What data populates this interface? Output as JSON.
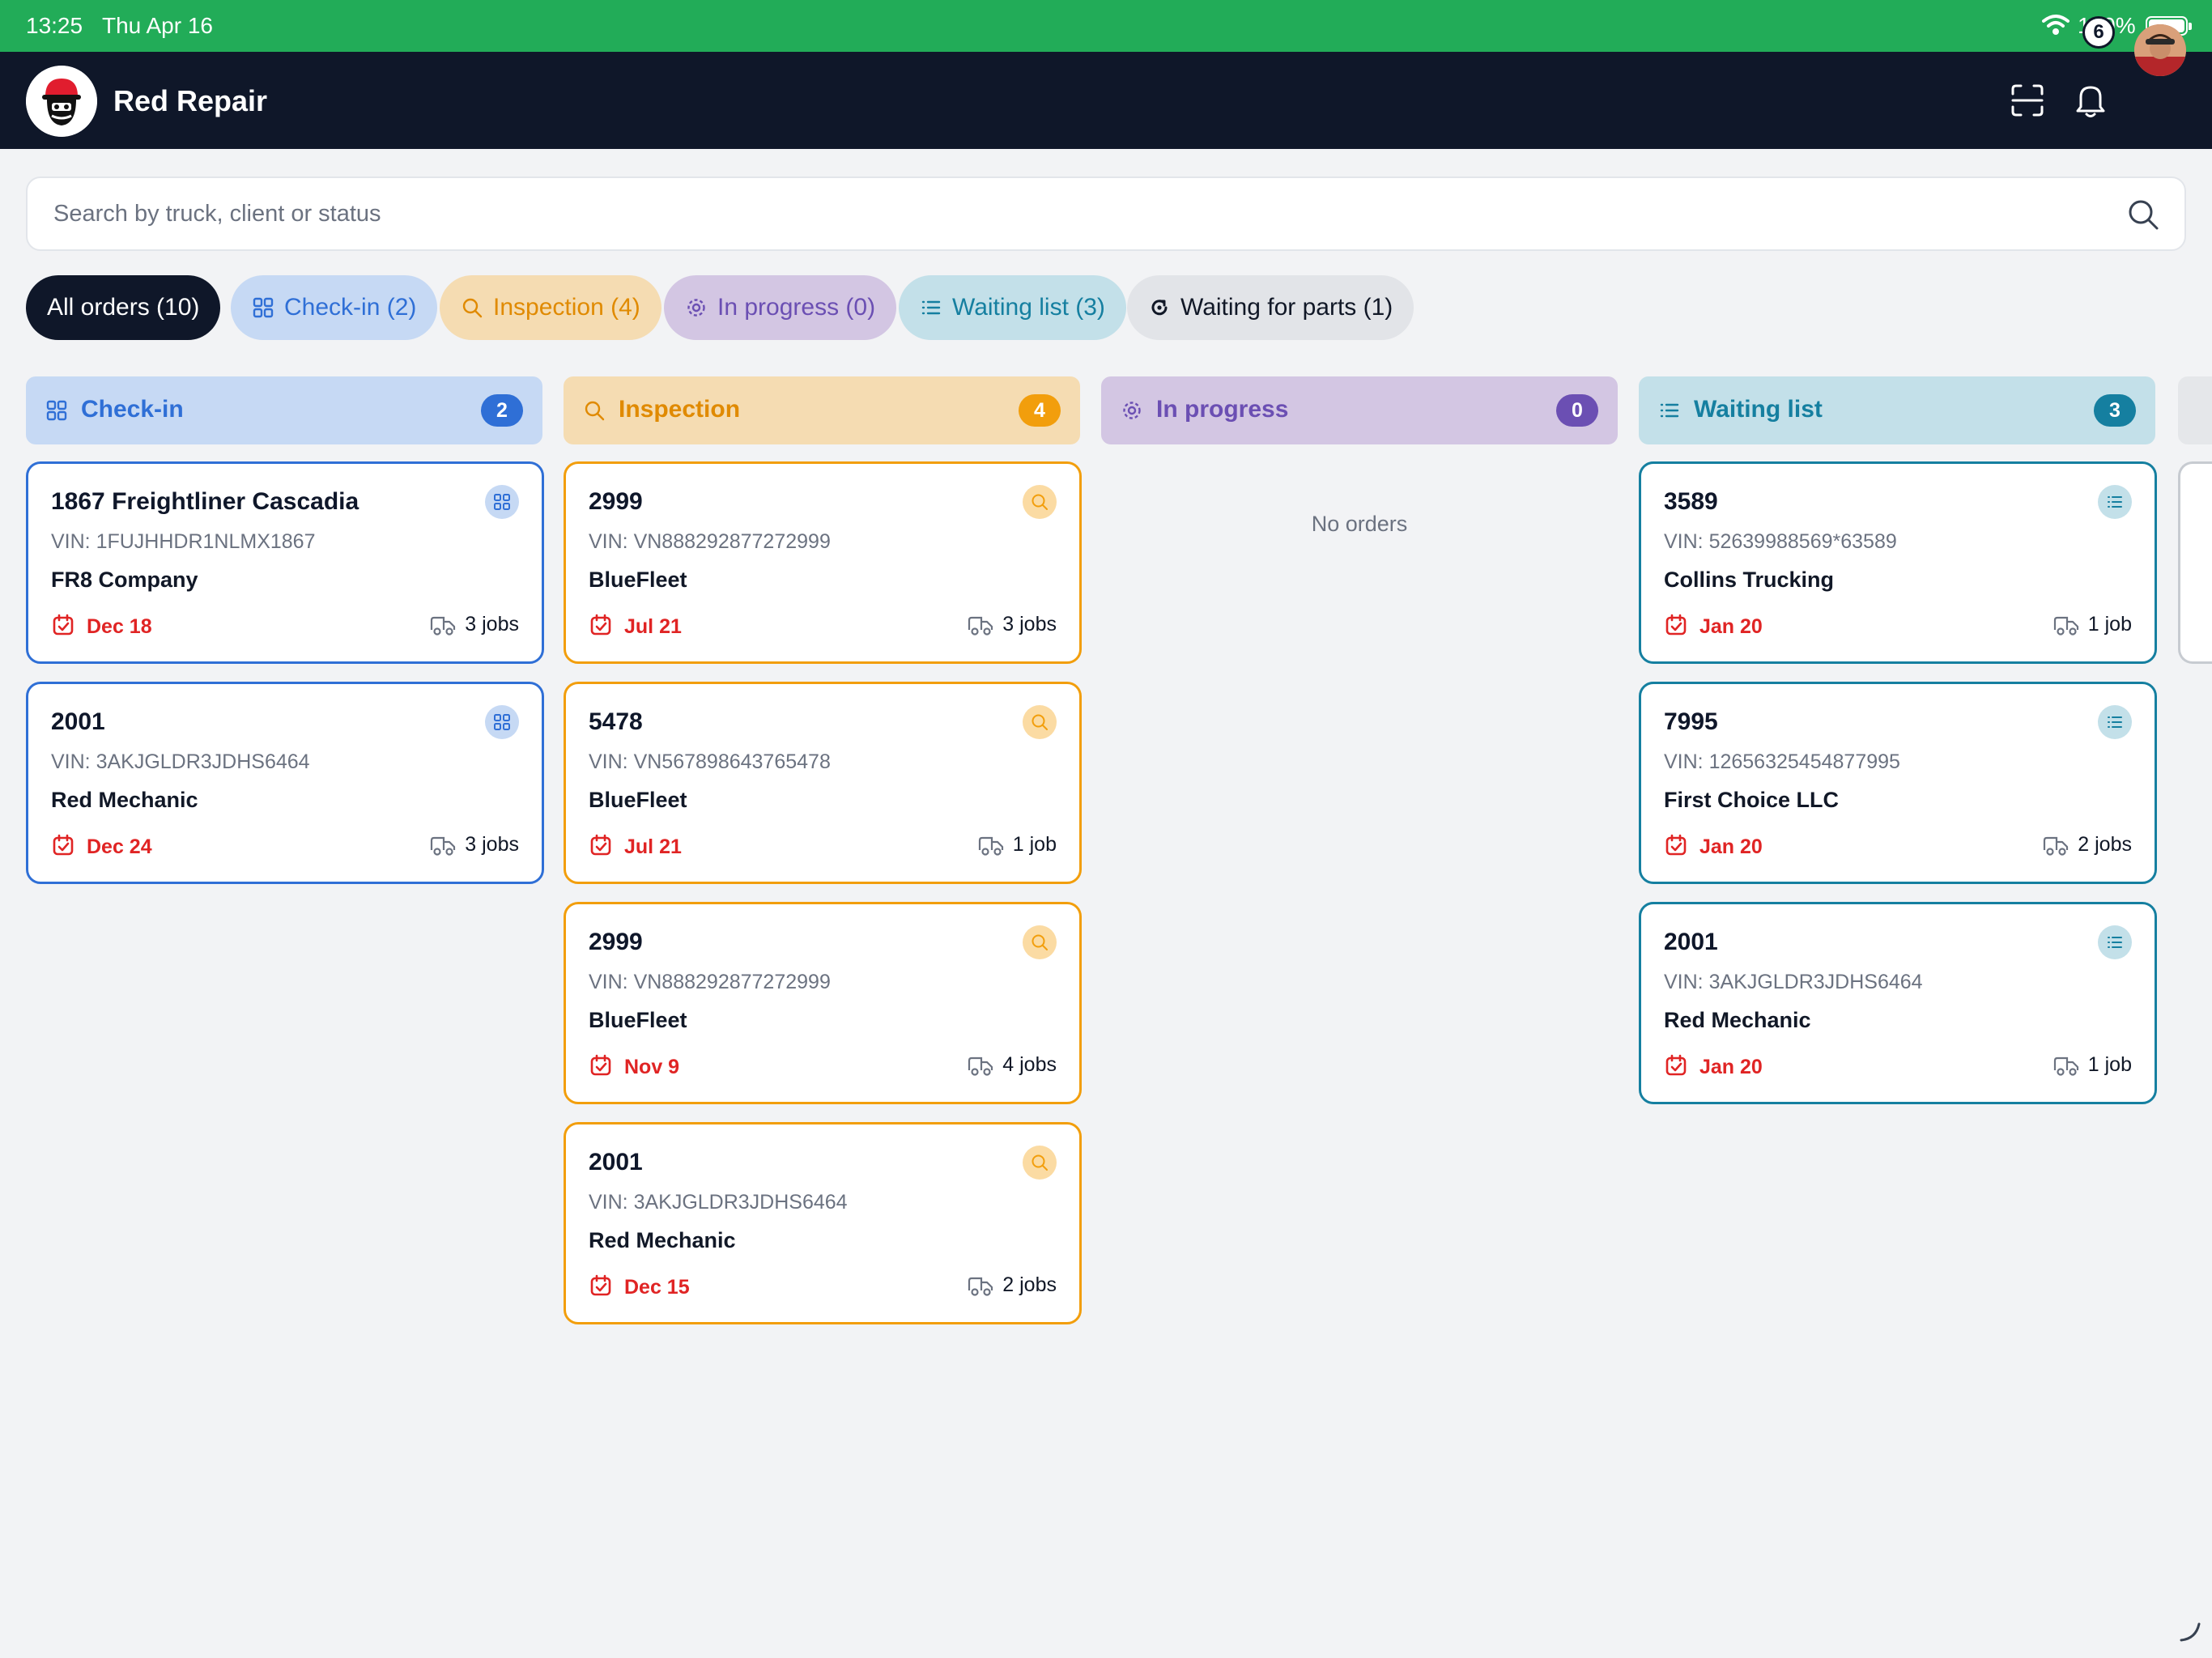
{
  "status_bar": {
    "time": "13:25",
    "date": "Thu Apr 16",
    "battery": "100%"
  },
  "app": {
    "title": "Red Repair",
    "notification_count": "6"
  },
  "search": {
    "placeholder": "Search by truck, client or status"
  },
  "filters": [
    {
      "label": "All orders (10)"
    },
    {
      "label": "Check-in (2)"
    },
    {
      "label": "Inspection (4)"
    },
    {
      "label": "In progress (0)"
    },
    {
      "label": "Waiting list (3)"
    },
    {
      "label": "Waiting for parts (1)"
    }
  ],
  "colors": {
    "checkin": "#2f6fd6",
    "checkin_bg": "#c6d9f4",
    "inspection": "#f29e0c",
    "inspection_bg": "#f5dcb2",
    "progress": "#6b4fb3",
    "progress_bg": "#d3c6e3",
    "waiting": "#157fa0",
    "waiting_bg": "#c3e0e9",
    "date_red": "#e02424"
  },
  "columns": [
    {
      "name": "Check-in",
      "count": "2",
      "icon": "grid-icon",
      "cards": [
        {
          "title": "1867 Freightliner Cascadia",
          "vin": "VIN: 1FUJHHDR1NLMX1867",
          "client": "FR8 Company",
          "date": "Dec 18",
          "jobs": "3 jobs"
        },
        {
          "title": "2001",
          "vin": "VIN: 3AKJGLDR3JDHS6464",
          "client": "Red Mechanic",
          "date": "Dec 24",
          "jobs": "3 jobs"
        }
      ]
    },
    {
      "name": "Inspection",
      "count": "4",
      "icon": "search-icon",
      "cards": [
        {
          "title": "2999",
          "vin": "VIN: VN888292877272999",
          "client": "BlueFleet",
          "date": "Jul 21",
          "jobs": "3 jobs"
        },
        {
          "title": "5478",
          "vin": "VIN: VN567898643765478",
          "client": "BlueFleet",
          "date": "Jul 21",
          "jobs": "1 job"
        },
        {
          "title": "2999",
          "vin": "VIN: VN888292877272999",
          "client": "BlueFleet",
          "date": "Nov 9",
          "jobs": "4 jobs"
        },
        {
          "title": "2001",
          "vin": "VIN: 3AKJGLDR3JDHS6464",
          "client": "Red Mechanic",
          "date": "Dec 15",
          "jobs": "2 jobs"
        }
      ]
    },
    {
      "name": "In progress",
      "count": "0",
      "icon": "gear-icon",
      "empty_text": "No orders"
    },
    {
      "name": "Waiting list",
      "count": "3",
      "icon": "list-icon",
      "cards": [
        {
          "title": "3589",
          "vin": "VIN: 52639988569*63589",
          "client": "Collins Trucking",
          "date": "Jan 20",
          "jobs": "1 job"
        },
        {
          "title": "7995",
          "vin": "VIN: 12656325454877995",
          "client": "First Choice LLC",
          "date": "Jan 20",
          "jobs": "2 jobs"
        },
        {
          "title": "2001",
          "vin": "VIN: 3AKJGLDR3JDHS6464",
          "client": "Red Mechanic",
          "date": "Jan 20",
          "jobs": "1 job"
        }
      ]
    }
  ]
}
